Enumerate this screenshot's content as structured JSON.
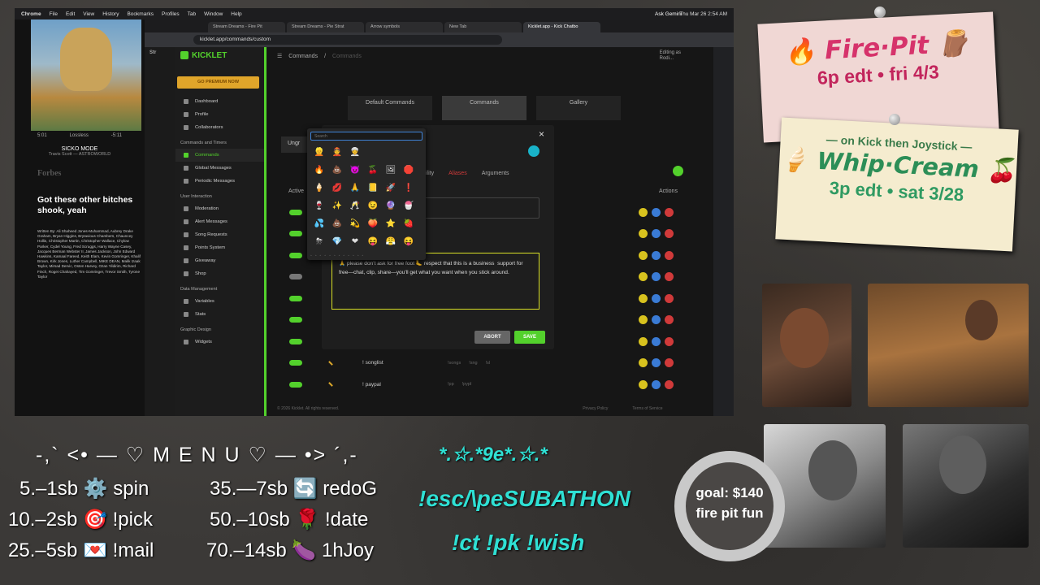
{
  "menubar": {
    "app": "Chrome",
    "items": [
      "File",
      "Edit",
      "View",
      "History",
      "Bookmarks",
      "Profiles",
      "Tab",
      "Window",
      "Help"
    ],
    "clock": "Thu Mar 26  2:54 AM"
  },
  "music": {
    "time_elapsed": "5:01",
    "quality": "Lossless",
    "time_remaining": "-5:11",
    "title": "SICKO MODE",
    "artist_album": "Travis Scott — ASTROWORLD",
    "source": "Forbes",
    "lyric": "Got these other bitches shook, yeah",
    "credits": "Written By: Ali Shaheed Jones-Muhammad, Aubrey Drake Graham, Bryan Higgins, Brytavious Chambers, Chauncey Hollis, Christopher Martin, Christopher Wallace, Chylow Parker, Cydel Young, Fred Scruggs, Harry Wayne Casey, Jacques Berman Webster II, James Jackson, John Edward Hawkins, Kamaal Fareed, Keith Elam, Kevin Gomringer, Khalif Brown, Kirk Jones, Luther Campbell, MIKE DEAN, Malik Izaak Taylor, Mirsad Dervic, Osten Harvey, Ozan Yildirim, Richard Finch, Roget Chahayed, Tim Gomringer, Trevor Smith, Tyrone Taylor"
  },
  "browser": {
    "tabs": [
      "Stream Dreams - Fire Pit",
      "Stream Dreams - Pie Strat",
      "Arrow symbols",
      "New Tab",
      "Kicklet.app - Kick Chatbo"
    ],
    "url": "kicklet.app/commands/custom",
    "ask": "Ask Gemini",
    "left_labels": [
      "Str",
      "Stre"
    ]
  },
  "kicklet": {
    "brand": "KICKLET",
    "premium": "GO PREMIUM NOW",
    "nav_top": [
      "Dashboard",
      "Profile",
      "Collaborators"
    ],
    "sec1": "Commands and Timers",
    "nav_cmds": [
      "Commands",
      "Global Messages",
      "Periodic Messages"
    ],
    "sec2": "User Interaction",
    "nav_user": [
      "Moderation",
      "Alert Messages",
      "Song Requests",
      "Points System",
      "Giveaway",
      "Shop"
    ],
    "sec3": "Data Management",
    "nav_data": [
      "Variables",
      "Stats"
    ],
    "sec4": "Graphic Design",
    "nav_gfx": [
      "Widgets",
      "Panel Generator"
    ],
    "breadcrumb": "Commands",
    "breadcrumb_sub": "Commands",
    "editing": "Editing as",
    "editing_user": "Rodi...",
    "segtabs": [
      "Default Commands",
      "Commands",
      "Gallery"
    ],
    "active_col": "Active",
    "actions_col": "Actions",
    "rows": [
      {
        "cmd": "",
        "aliases": []
      },
      {
        "cmd": "",
        "aliases": []
      },
      {
        "cmd": "",
        "aliases": []
      },
      {
        "cmd": "",
        "aliases": []
      },
      {
        "cmd": "",
        "aliases": []
      },
      {
        "cmd": "",
        "aliases": []
      },
      {
        "cmd": "",
        "aliases": []
      },
      {
        "cmd": "! songlist",
        "aliases": [
          "!songs",
          "!sng",
          "!sl"
        ]
      },
      {
        "cmd": "! paypal",
        "aliases": [
          "!pp",
          "!pypl"
        ]
      }
    ],
    "footer": "© 2026 Kicklet. All rights reserved.",
    "privacy": "Privacy Policy",
    "tos": "Terms of Service"
  },
  "modal": {
    "group": "Ungr",
    "tab_visibility": "ility",
    "tab_aliases": "Aliases",
    "tab_arguments": "Arguments",
    "message": "🙏 please don't ask for free foot 🦶 respect that this is a business  support for free—chat, clip, share—you'll get what you want when you stick around.",
    "abort": "ABORT",
    "save": "SAVE",
    "close": "×"
  },
  "picker": {
    "placeholder": "Search",
    "emojis": [
      "👱",
      "👲",
      "👳",
      "",
      "",
      "",
      "🔥",
      "💩",
      "😈",
      "🍒",
      "🖼",
      "🛑",
      "🍦",
      "💋",
      "🙏",
      "📒",
      "🚀",
      "❗",
      "🍷",
      "✨",
      "🥂",
      "😉",
      "🔮",
      "🍧",
      "💦",
      "💩",
      "💫",
      "🍑",
      "⭐",
      "🍓",
      "⛈",
      "💎",
      "❤",
      "😝",
      "😤",
      "😝"
    ]
  },
  "poster1": {
    "title": "🔥 Fire·Pit 🪵",
    "time": "6p edt • fri 4/3"
  },
  "poster2": {
    "sub": "— on Kick then Joystick —",
    "title": "🍦 Whip·Cream 🍒",
    "time": "3p edt • sat 3/28"
  },
  "overlay": {
    "menu_title": "-,` <• — ♡ M E N U ♡ — •> ´,-",
    "items": [
      {
        "label": "5.–1sb ⚙️ spin"
      },
      {
        "label": "35.—7sb 🔄 redoG"
      },
      {
        "label": "10.–2sb 🎯 !pick"
      },
      {
        "label": "50.–10sb 🌹 !date"
      },
      {
        "label": "25.–5sb 💌 !mail"
      },
      {
        "label": "70.–14sb 🍆 1hJoy"
      }
    ],
    "stars": "*.☆.*9e*.☆.*",
    "subathon": "!esc/\\peSUBATHON",
    "commands": "!ct !pk !wish",
    "goal_amount": "goal: $140",
    "goal_label": "fire pit fun"
  },
  "cam_label": "he",
  "colors": {
    "accent": "#53d12c",
    "teal": "#2fe0d4",
    "fire": "#d6336b",
    "cream": "#2c8e57"
  }
}
